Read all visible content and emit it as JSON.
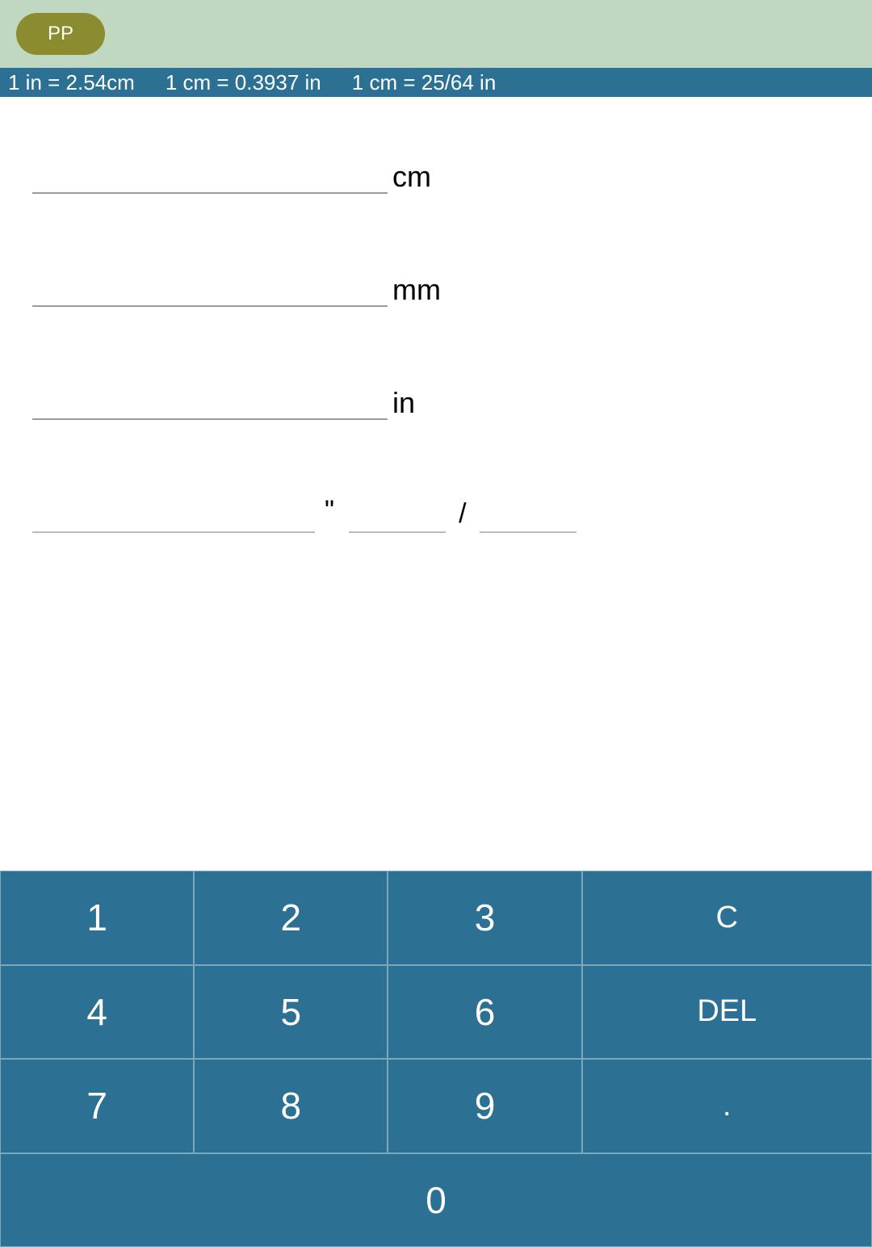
{
  "topbar": {
    "pill_label": "PP"
  },
  "infobar": {
    "item1": "1 in = 2.54cm",
    "item2": "1 cm = 0.3937 in",
    "item3": "1 cm = 25/64 in"
  },
  "fields": {
    "cm": {
      "unit": "cm",
      "value": ""
    },
    "mm": {
      "unit": "mm",
      "value": ""
    },
    "in": {
      "unit": "in",
      "value": ""
    },
    "frac": {
      "whole": "",
      "quote": "\"",
      "num": "",
      "slash": "/",
      "den": ""
    }
  },
  "keypad": {
    "r1": {
      "k1": "1",
      "k2": "2",
      "k3": "3",
      "k4": "C"
    },
    "r2": {
      "k1": "4",
      "k2": "5",
      "k3": "6",
      "k4": "DEL"
    },
    "r3": {
      "k1": "7",
      "k2": "8",
      "k3": "9",
      "k4": "."
    },
    "r4": {
      "k1": "0"
    }
  }
}
